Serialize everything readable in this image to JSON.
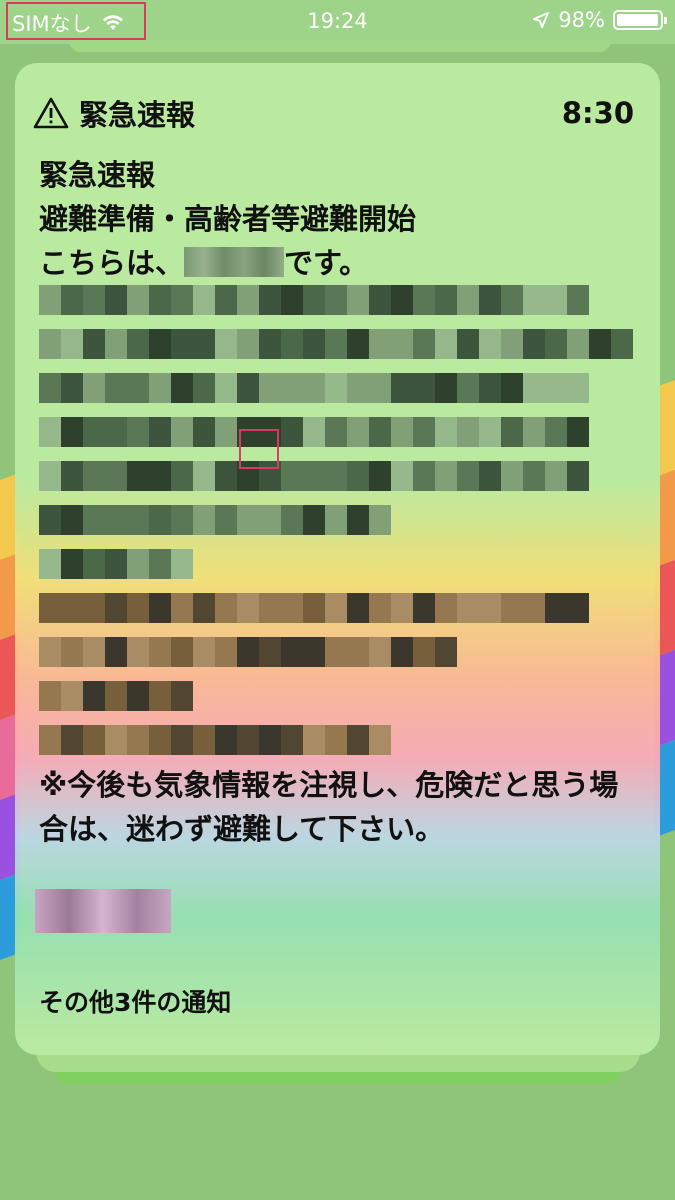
{
  "status_bar": {
    "carrier": "SIMなし",
    "time": "19:24",
    "battery_text": "98%",
    "battery_level": 0.98,
    "icons": [
      "wifi-icon",
      "location-arrow-icon",
      "battery-icon"
    ]
  },
  "notification": {
    "app_name": "緊急速報",
    "time": "8:30",
    "title": "緊急速報",
    "subtitle": "避難準備・高齢者等避難開始",
    "intro_prefix": "こちらは、",
    "intro_suffix": "です。",
    "advice": "※今後も気象情報を注視し、危険だと思う場合は、迷わず避難して下さい。",
    "more_notifications": "その他3件の通知"
  },
  "colors": {
    "highlight_box": "#d83a62",
    "background": "#8fc57a",
    "card_green": "#baeaa0"
  }
}
